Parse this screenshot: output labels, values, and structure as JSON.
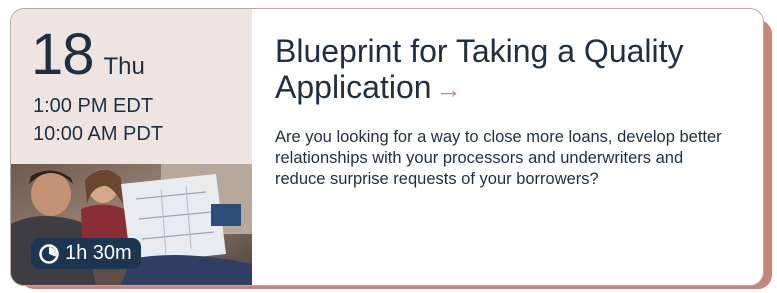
{
  "event": {
    "day_number": "18",
    "day_name": "Thu",
    "time_edt": "1:00 PM EDT",
    "time_pdt": "10:00 AM PDT",
    "duration": "1h 30m",
    "title": "Blueprint for Taking a Quality Application",
    "title_arrow": "→",
    "description": "Are you looking for a way to close more loans, develop better relationships with your processors and underwriters and reduce surprise requests of your borrowers?"
  },
  "colors": {
    "accent": "#c9857b",
    "navy": "#1f2f3f",
    "badge_bg": "#1c3550",
    "left_panel_bg": "#eee5e2"
  },
  "icons": {
    "duration": "clock-icon",
    "title_arrow": "arrow-right-icon"
  }
}
